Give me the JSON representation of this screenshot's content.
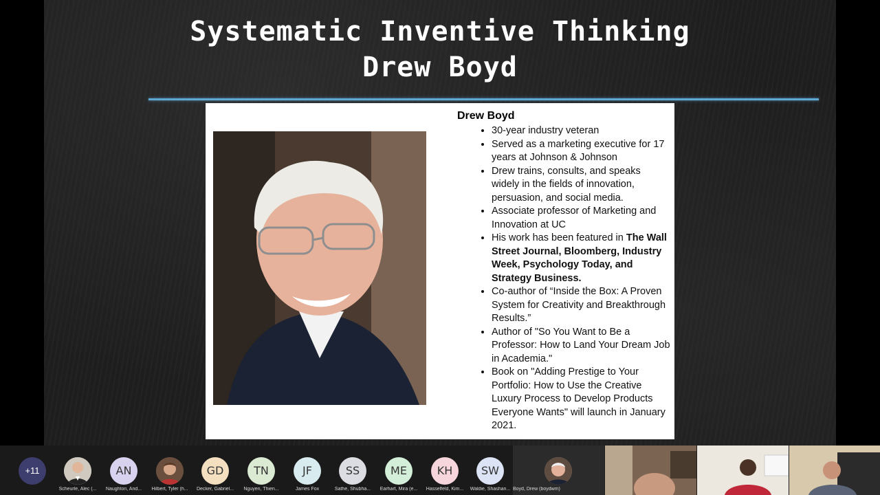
{
  "slide": {
    "title_line1": "Systematic Inventive Thinking",
    "title_line2": "Drew Boyd",
    "accent_color": "#5fa8d3",
    "bio": {
      "name": "Drew Boyd",
      "bullets": [
        "30-year industry veteran",
        "Served as a marketing executive for 17 years at Johnson & Johnson",
        "Drew trains, consults, and speaks widely in the fields of innovation, persuasion, and social media.",
        "Associate professor of Marketing and Innovation at UC",
        "Co-author of “Inside the Box: A Proven System for Creativity and Breakthrough Results.”",
        "Author of \"So You Want to Be a Professor: How to Land Your Dream Job in Academia.\"",
        "Book on \"Adding Prestige to Your Portfolio: How to Use the Creative Luxury Process to Develop Products Everyone Wants\" will launch in January 2021."
      ],
      "featured_prefix": "His work has been featured in ",
      "featured_bold": "The Wall Street Journal, Bloomberg, Industry Week, Psychology Today, and Strategy Business."
    }
  },
  "participants": {
    "more_count": "+11",
    "tiles": [
      {
        "initials": "",
        "name": "Scheurle, Alec (..."
      },
      {
        "initials": "AN",
        "name": "Naughton, And...",
        "color": "#d9d2ee"
      },
      {
        "initials": "",
        "name": "Hilbert, Tyler (h..."
      },
      {
        "initials": "GD",
        "name": "Decker, Gabriel...",
        "color": "#f4dfc0"
      },
      {
        "initials": "TN",
        "name": "Nguyen, Thien...",
        "color": "#dbead2"
      },
      {
        "initials": "JF",
        "name": "James Fox",
        "color": "#d8ecf0"
      },
      {
        "initials": "SS",
        "name": "Sathe, Shubha...",
        "color": "#dcdde3"
      },
      {
        "initials": "ME",
        "name": "Earhart, Mira (e...",
        "color": "#d4efd9"
      },
      {
        "initials": "KH",
        "name": "Hasselfeld, Kim...",
        "color": "#f6d6dc"
      },
      {
        "initials": "SW",
        "name": "Waldie, Shashan...",
        "color": "#dbe3f4"
      }
    ],
    "speaker": {
      "name": "Boyd, Drew (boydwm)"
    }
  }
}
